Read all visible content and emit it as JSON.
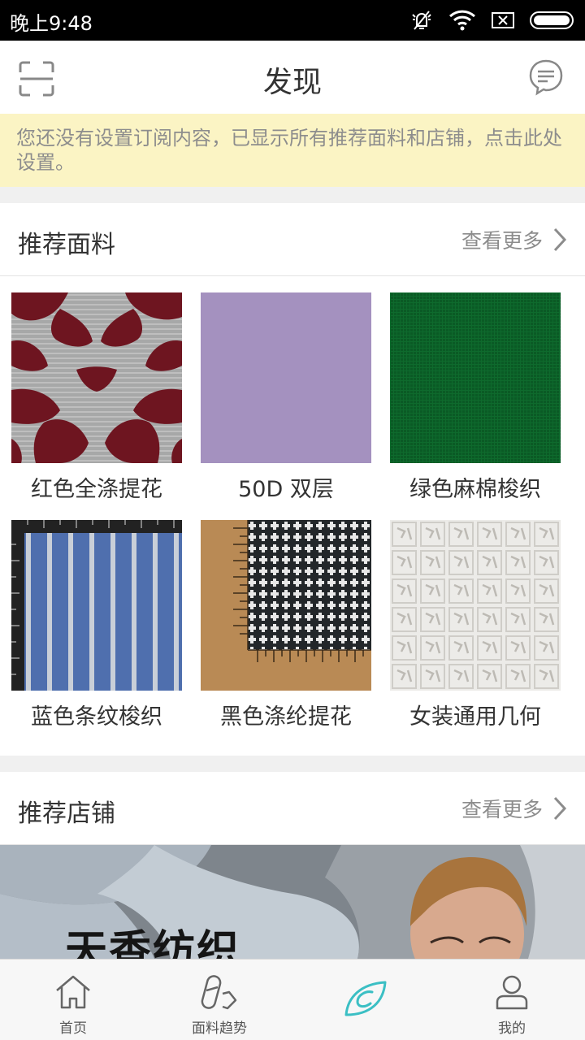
{
  "status_bar": {
    "time": "晚上9:48"
  },
  "header": {
    "title": "发现"
  },
  "notice": {
    "text": "您还没有设置订阅内容，已显示所有推荐面料和店铺，点击此处设置。"
  },
  "fabrics_section": {
    "title": "推荐面料",
    "more_label": "查看更多",
    "items": [
      {
        "name": "红色全涤提花",
        "swatch": "red-white-floral-jacquard"
      },
      {
        "name": "50D 双层",
        "swatch": "lavender-plain"
      },
      {
        "name": "绿色麻棉梭织",
        "swatch": "green-linen"
      },
      {
        "name": "蓝色条纹梭织",
        "swatch": "blue-stripe-with-ruler"
      },
      {
        "name": "黑色涤纶提花",
        "swatch": "black-dot-with-ruler"
      },
      {
        "name": "女装通用几何",
        "swatch": "white-embossed-geometric"
      }
    ]
  },
  "shops_section": {
    "title": "推荐店铺",
    "more_label": "查看更多",
    "banner": {
      "shop_name": "天香纺织"
    }
  },
  "tab_bar": {
    "active_index": 2,
    "active_color": "#3bbfc4",
    "tabs": [
      {
        "label": "首页",
        "icon": "home-icon"
      },
      {
        "label": "面料趋势",
        "icon": "trend-icon"
      },
      {
        "label": "",
        "icon": "discover-eye-icon"
      },
      {
        "label": "我的",
        "icon": "user-icon"
      }
    ]
  }
}
